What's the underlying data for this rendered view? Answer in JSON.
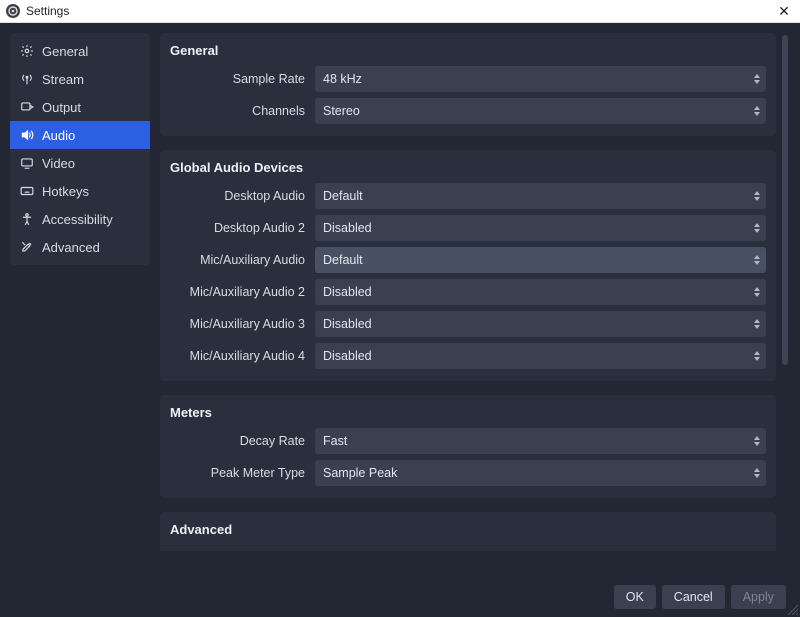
{
  "window": {
    "title": "Settings"
  },
  "sidebar": {
    "items": [
      {
        "label": "General"
      },
      {
        "label": "Stream"
      },
      {
        "label": "Output"
      },
      {
        "label": "Audio"
      },
      {
        "label": "Video"
      },
      {
        "label": "Hotkeys"
      },
      {
        "label": "Accessibility"
      },
      {
        "label": "Advanced"
      }
    ],
    "selected_index": 3
  },
  "sections": {
    "general": {
      "title": "General",
      "sample_rate": {
        "label": "Sample Rate",
        "value": "48 kHz"
      },
      "channels": {
        "label": "Channels",
        "value": "Stereo"
      }
    },
    "devices": {
      "title": "Global Audio Devices",
      "desktop1": {
        "label": "Desktop Audio",
        "value": "Default"
      },
      "desktop2": {
        "label": "Desktop Audio 2",
        "value": "Disabled"
      },
      "mic1": {
        "label": "Mic/Auxiliary Audio",
        "value": "Default"
      },
      "mic2": {
        "label": "Mic/Auxiliary Audio 2",
        "value": "Disabled"
      },
      "mic3": {
        "label": "Mic/Auxiliary Audio 3",
        "value": "Disabled"
      },
      "mic4": {
        "label": "Mic/Auxiliary Audio 4",
        "value": "Disabled"
      }
    },
    "meters": {
      "title": "Meters",
      "decay": {
        "label": "Decay Rate",
        "value": "Fast"
      },
      "peak_type": {
        "label": "Peak Meter Type",
        "value": "Sample Peak"
      }
    },
    "advanced": {
      "title": "Advanced"
    }
  },
  "footer": {
    "ok": "OK",
    "cancel": "Cancel",
    "apply": "Apply"
  }
}
